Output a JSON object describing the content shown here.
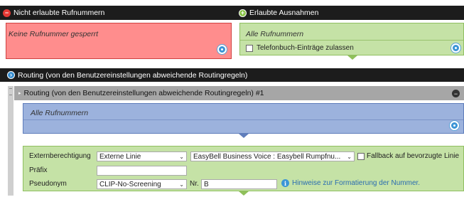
{
  "blocked": {
    "header": "Nicht erlaubte Rufnummern",
    "value": "Keine Rufnummer gesperrt"
  },
  "allowed": {
    "header": "Erlaubte Ausnahmen",
    "value": "Alle Rufnummern",
    "phonebook_label": "Telefonbuch-Einträge zulassen"
  },
  "routing": {
    "header": "Routing (von den Benutzereinstellungen abweichende Routingregeln)",
    "rule_title": "Routing (von den Benutzereinstellungen abweichende Routingregeln) #1",
    "numbers_value": "Alle Rufnummern",
    "form": {
      "ext_label": "Externberechtigung",
      "ext_value": "Externe Linie",
      "trunk_value": "EasyBell Business Voice : Easybell Rumpfnu...",
      "fallback_label": "Fallback auf bevorzugte Linie",
      "prefix_label": "Präfix",
      "prefix_value": "",
      "pseudonym_label": "Pseudonym",
      "pseudonym_value": "CLIP-No-Screening",
      "nr_label": "Nr.",
      "nr_value": "B",
      "hint": "Hinweise zur Formatierung der Nummer."
    }
  }
}
